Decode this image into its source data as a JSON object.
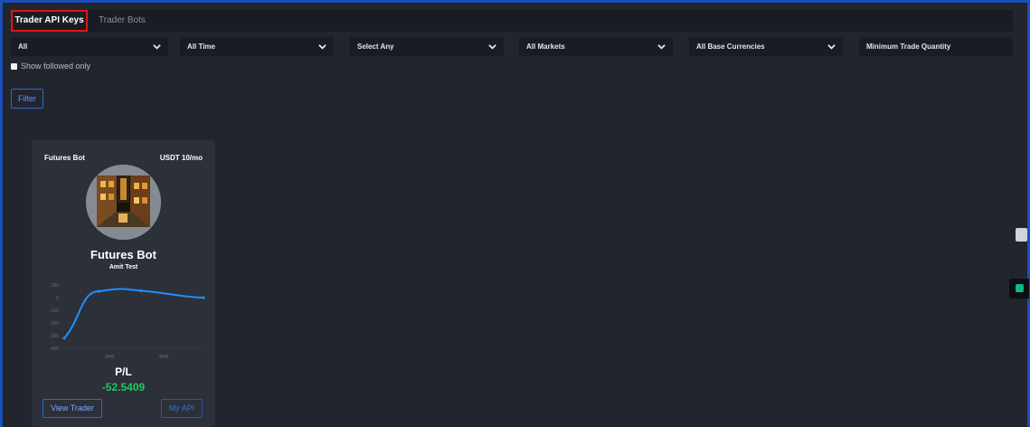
{
  "tabs": [
    {
      "label": "Trader API Keys",
      "active": true
    },
    {
      "label": "Trader Bots",
      "active": false
    }
  ],
  "filters": {
    "type": "All",
    "time": "All Time",
    "select": "Select Any",
    "markets": "All Markets",
    "currencies": "All Base Currencies",
    "min_qty_placeholder": "Minimum Trade Quantity"
  },
  "show_followed_label": "Show followed only",
  "filter_button": "Filter",
  "card": {
    "type": "Futures Bot",
    "price": "USDT 10/mo",
    "name": "Futures Bot",
    "owner": "Amit Test",
    "pl_label": "P/L",
    "pl_value": "-52.5409",
    "view_button": "View Trader",
    "api_button": "My API"
  },
  "chart_data": {
    "type": "line",
    "y_ticks": [
      "100",
      "0",
      "-100",
      "-200",
      "-300",
      "-400"
    ],
    "x_ticks": [
      "3PM",
      "4PM"
    ],
    "ylim": [
      -400,
      100
    ],
    "series": [
      {
        "points": [
          [
            0,
            -320
          ],
          [
            0.25,
            50
          ],
          [
            0.55,
            55
          ],
          [
            1,
            0
          ]
        ]
      }
    ],
    "line_color": "#1e90ff"
  },
  "colors": {
    "accent": "#2b67d6",
    "pl_value": "#22c55e",
    "active_tab_border": "#e11414"
  }
}
